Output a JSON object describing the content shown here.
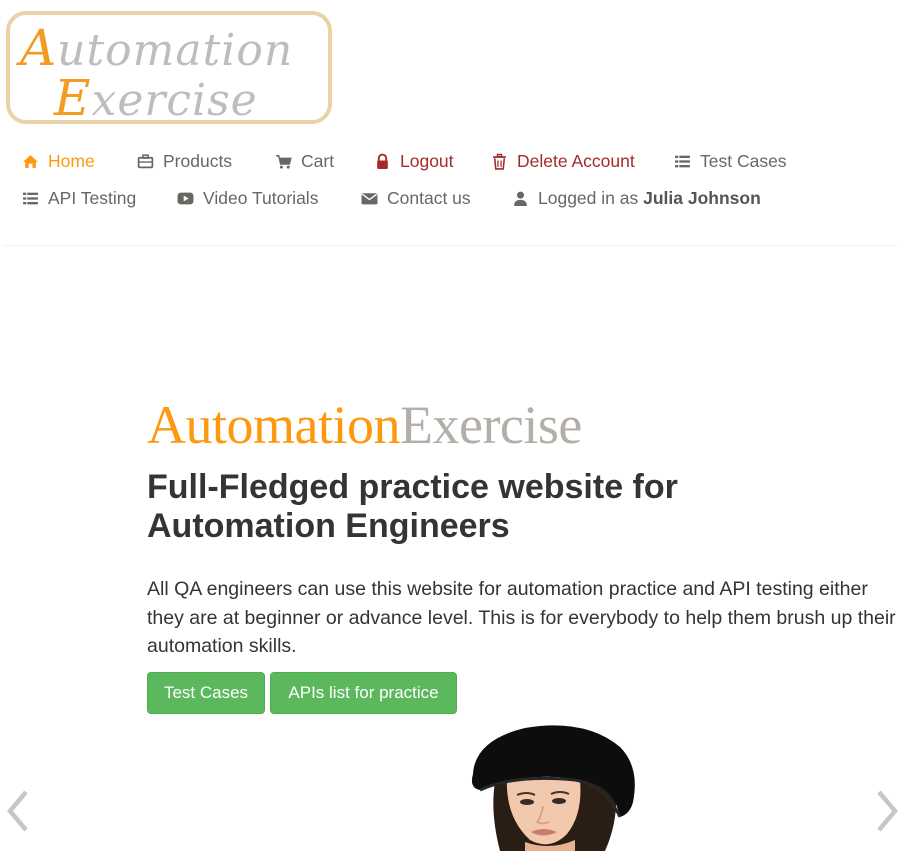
{
  "logo": {
    "line1_initial": "A",
    "line1_rest": "utomation",
    "line2_initial": "E",
    "line2_rest": "xercise"
  },
  "nav": {
    "home": {
      "label": "Home",
      "icon": "home-icon"
    },
    "products": {
      "label": "Products",
      "icon": "briefcase-icon"
    },
    "cart": {
      "label": "Cart",
      "icon": "cart-icon"
    },
    "logout": {
      "label": "Logout",
      "icon": "lock-icon"
    },
    "delete_account": {
      "label": "Delete Account",
      "icon": "trash-icon"
    },
    "test_cases": {
      "label": "Test Cases",
      "icon": "list-icon"
    },
    "api_testing": {
      "label": "API Testing",
      "icon": "list-icon"
    },
    "video_tutorials": {
      "label": "Video Tutorials",
      "icon": "youtube-play-icon"
    },
    "contact_us": {
      "label": "Contact us",
      "icon": "envelope-icon"
    },
    "logged_in_prefix": "Logged in as",
    "logged_in_user": "Julia Johnson"
  },
  "hero": {
    "brand_part1": "Automation",
    "brand_part2": "Exercise",
    "headline": "Full-Fledged practice website for Automation Engineers",
    "description": "All QA engineers can use this website for automation practice and API testing either they are at beginner or advance level. This is for everybody to help them brush up their automation skills.",
    "button_test_cases": "Test Cases",
    "button_apis": "APIs list for practice"
  },
  "colors": {
    "accent": "#fe980f",
    "danger": "#a52a2a",
    "button": "#5cb85c",
    "text": "#363432",
    "nav_text": "#696763"
  }
}
